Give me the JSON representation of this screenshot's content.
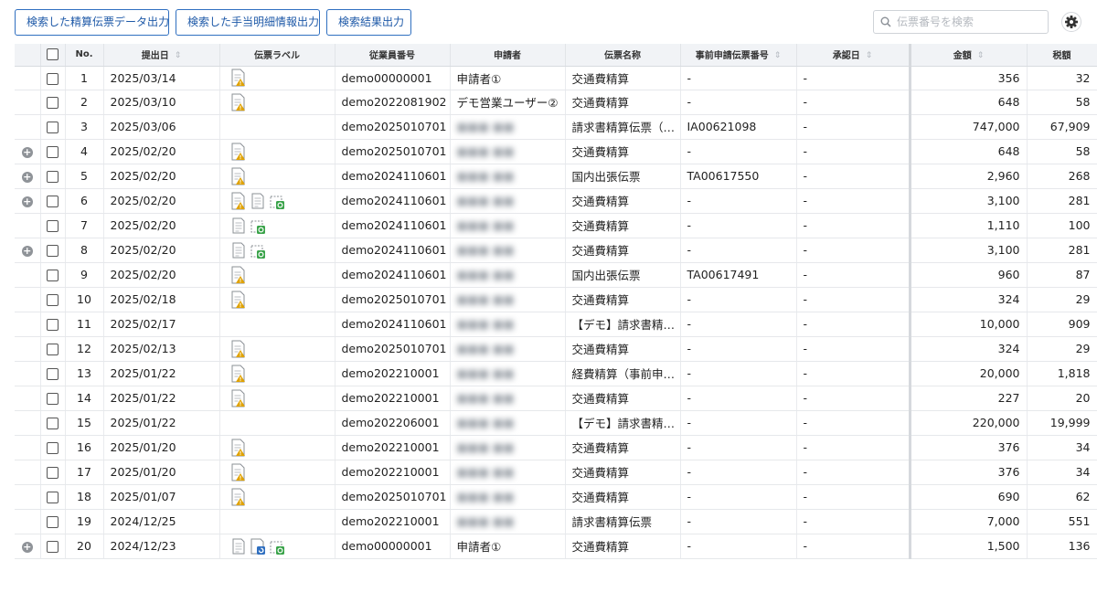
{
  "toolbar": {
    "export_slip_label": "検索した精算伝票データ出力",
    "export_allowance_label": "検索した手当明細情報出力",
    "export_results_label": "検索結果出力"
  },
  "search": {
    "placeholder": "伝票番号を検索"
  },
  "columns": {
    "no": "No.",
    "submit_date": "提出日",
    "label": "伝票ラベル",
    "employee_id": "従業員番号",
    "applicant": "申請者",
    "slip_name": "伝票名称",
    "pre_slip_no": "事前申請伝票番号",
    "approve_date": "承認日",
    "amount": "金額",
    "tax": "税額"
  },
  "icons": {
    "label_warning": "document-warning-icon",
    "label_plain": "document-icon",
    "label_receipt": "receipt-check-icon",
    "label_approval": "document-approval-icon",
    "expand": "plus-circle-icon",
    "settings": "gear-icon",
    "search": "search-icon",
    "sort": "sort-icon"
  },
  "colors": {
    "accent": "#2f6fc0",
    "warning_icon": "#e0a200",
    "receipt_icon": "#3aa34a",
    "approval_icon": "#2f6fc0"
  },
  "rows": [
    {
      "expand": false,
      "no": "1",
      "date": "2025/03/14",
      "labels": [
        "warn"
      ],
      "emp": "demo00000001",
      "applicant": "申請者①",
      "blurred": false,
      "name": "交通費精算",
      "pre": "-",
      "approved": "-",
      "amount": "356",
      "tax": "32"
    },
    {
      "expand": false,
      "no": "2",
      "date": "2025/03/10",
      "labels": [
        "warn"
      ],
      "emp": "demo2022081902",
      "applicant": "デモ営業ユーザー②",
      "blurred": false,
      "name": "交通費精算",
      "pre": "-",
      "approved": "-",
      "amount": "648",
      "tax": "58"
    },
    {
      "expand": false,
      "no": "3",
      "date": "2025/03/06",
      "labels": [],
      "emp": "demo2025010701",
      "applicant": "",
      "blurred": true,
      "name": "請求書精算伝票（…",
      "pre": "IA00621098",
      "approved": "-",
      "amount": "747,000",
      "tax": "67,909"
    },
    {
      "expand": true,
      "no": "4",
      "date": "2025/02/20",
      "labels": [
        "warn"
      ],
      "emp": "demo2025010701",
      "applicant": "",
      "blurred": true,
      "name": "交通費精算",
      "pre": "-",
      "approved": "-",
      "amount": "648",
      "tax": "58"
    },
    {
      "expand": true,
      "no": "5",
      "date": "2025/02/20",
      "labels": [
        "warn"
      ],
      "emp": "demo2024110601",
      "applicant": "",
      "blurred": true,
      "name": "国内出張伝票",
      "pre": "TA00617550",
      "approved": "-",
      "amount": "2,960",
      "tax": "268"
    },
    {
      "expand": true,
      "no": "6",
      "date": "2025/02/20",
      "labels": [
        "warn",
        "doc",
        "receipt"
      ],
      "emp": "demo2024110601",
      "applicant": "",
      "blurred": true,
      "name": "交通費精算",
      "pre": "-",
      "approved": "-",
      "amount": "3,100",
      "tax": "281"
    },
    {
      "expand": false,
      "no": "7",
      "date": "2025/02/20",
      "labels": [
        "doc",
        "receipt"
      ],
      "emp": "demo2024110601",
      "applicant": "",
      "blurred": true,
      "name": "交通費精算",
      "pre": "-",
      "approved": "-",
      "amount": "1,110",
      "tax": "100"
    },
    {
      "expand": true,
      "no": "8",
      "date": "2025/02/20",
      "labels": [
        "doc",
        "receipt"
      ],
      "emp": "demo2024110601",
      "applicant": "",
      "blurred": true,
      "name": "交通費精算",
      "pre": "-",
      "approved": "-",
      "amount": "3,100",
      "tax": "281"
    },
    {
      "expand": false,
      "no": "9",
      "date": "2025/02/20",
      "labels": [
        "warn"
      ],
      "emp": "demo2024110601",
      "applicant": "",
      "blurred": true,
      "name": "国内出張伝票",
      "pre": "TA00617491",
      "approved": "-",
      "amount": "960",
      "tax": "87"
    },
    {
      "expand": false,
      "no": "10",
      "date": "2025/02/18",
      "labels": [
        "warn"
      ],
      "emp": "demo2025010701",
      "applicant": "",
      "blurred": true,
      "name": "交通費精算",
      "pre": "-",
      "approved": "-",
      "amount": "324",
      "tax": "29"
    },
    {
      "expand": false,
      "no": "11",
      "date": "2025/02/17",
      "labels": [],
      "emp": "demo2024110601",
      "applicant": "",
      "blurred": true,
      "name": "【デモ】請求書精…",
      "pre": "-",
      "approved": "-",
      "amount": "10,000",
      "tax": "909"
    },
    {
      "expand": false,
      "no": "12",
      "date": "2025/02/13",
      "labels": [
        "warn"
      ],
      "emp": "demo2025010701",
      "applicant": "",
      "blurred": true,
      "name": "交通費精算",
      "pre": "-",
      "approved": "-",
      "amount": "324",
      "tax": "29"
    },
    {
      "expand": false,
      "no": "13",
      "date": "2025/01/22",
      "labels": [
        "warn"
      ],
      "emp": "demo202210001",
      "applicant": "",
      "blurred": true,
      "name": "経費精算（事前申…",
      "pre": "-",
      "approved": "-",
      "amount": "20,000",
      "tax": "1,818"
    },
    {
      "expand": false,
      "no": "14",
      "date": "2025/01/22",
      "labels": [
        "warn"
      ],
      "emp": "demo202210001",
      "applicant": "",
      "blurred": true,
      "name": "交通費精算",
      "pre": "-",
      "approved": "-",
      "amount": "227",
      "tax": "20"
    },
    {
      "expand": false,
      "no": "15",
      "date": "2025/01/22",
      "labels": [],
      "emp": "demo202206001",
      "applicant": "",
      "blurred": true,
      "name": "【デモ】請求書精…",
      "pre": "-",
      "approved": "-",
      "amount": "220,000",
      "tax": "19,999"
    },
    {
      "expand": false,
      "no": "16",
      "date": "2025/01/20",
      "labels": [
        "warn"
      ],
      "emp": "demo202210001",
      "applicant": "",
      "blurred": true,
      "name": "交通費精算",
      "pre": "-",
      "approved": "-",
      "amount": "376",
      "tax": "34"
    },
    {
      "expand": false,
      "no": "17",
      "date": "2025/01/20",
      "labels": [
        "warn"
      ],
      "emp": "demo202210001",
      "applicant": "",
      "blurred": true,
      "name": "交通費精算",
      "pre": "-",
      "approved": "-",
      "amount": "376",
      "tax": "34"
    },
    {
      "expand": false,
      "no": "18",
      "date": "2025/01/07",
      "labels": [
        "warn"
      ],
      "emp": "demo2025010701",
      "applicant": "",
      "blurred": true,
      "name": "交通費精算",
      "pre": "-",
      "approved": "-",
      "amount": "690",
      "tax": "62"
    },
    {
      "expand": false,
      "no": "19",
      "date": "2024/12/25",
      "labels": [],
      "emp": "demo202210001",
      "applicant": "",
      "blurred": true,
      "name": "請求書精算伝票",
      "pre": "-",
      "approved": "-",
      "amount": "7,000",
      "tax": "551"
    },
    {
      "expand": true,
      "no": "20",
      "date": "2024/12/23",
      "labels": [
        "doc",
        "approval",
        "receipt"
      ],
      "emp": "demo00000001",
      "applicant": "申請者①",
      "blurred": false,
      "name": "交通費精算",
      "pre": "-",
      "approved": "-",
      "amount": "1,500",
      "tax": "136"
    }
  ]
}
